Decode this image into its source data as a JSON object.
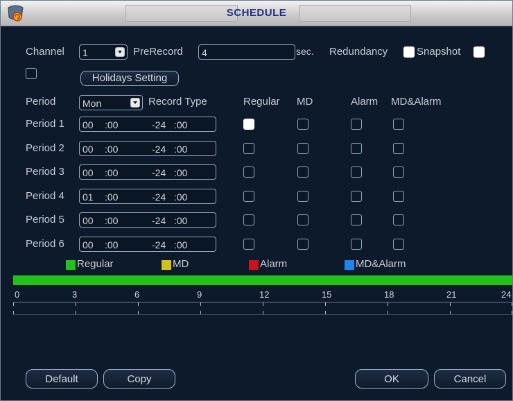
{
  "window": {
    "title": "SCHEDULE"
  },
  "channel": {
    "label": "Channel",
    "value": "1"
  },
  "prerecord": {
    "label": "PreRecord",
    "value": "4",
    "unit": "sec."
  },
  "redundancy": {
    "label": "Redundancy",
    "checked": false
  },
  "snapshot": {
    "label": "Snapshot",
    "checked": false
  },
  "holidays": {
    "button_label": "Holidays Setting",
    "checked": false
  },
  "header": {
    "period": "Period",
    "day": "Mon",
    "record_type": "Record Type",
    "regular": "Regular",
    "md": "MD",
    "alarm": "Alarm",
    "md_alarm": "MD&Alarm"
  },
  "periods": [
    {
      "label": "Period 1",
      "start_h": "00",
      "start_m": ":00",
      "end_h": "-24",
      "end_m": ":00",
      "regular": true,
      "md": false,
      "alarm": false,
      "md_alarm": false
    },
    {
      "label": "Period 2",
      "start_h": "00",
      "start_m": ":00",
      "end_h": "-24",
      "end_m": ":00",
      "regular": false,
      "md": false,
      "alarm": false,
      "md_alarm": false
    },
    {
      "label": "Period 3",
      "start_h": "00",
      "start_m": ":00",
      "end_h": "-24",
      "end_m": ":00",
      "regular": false,
      "md": false,
      "alarm": false,
      "md_alarm": false
    },
    {
      "label": "Period 4",
      "start_h": "01",
      "start_m": ":00",
      "end_h": "-24",
      "end_m": ":00",
      "regular": false,
      "md": false,
      "alarm": false,
      "md_alarm": false
    },
    {
      "label": "Period 5",
      "start_h": "00",
      "start_m": ":00",
      "end_h": "-24",
      "end_m": ":00",
      "regular": false,
      "md": false,
      "alarm": false,
      "md_alarm": false
    },
    {
      "label": "Period 6",
      "start_h": "00",
      "start_m": ":00",
      "end_h": "-24",
      "end_m": ":00",
      "regular": false,
      "md": false,
      "alarm": false,
      "md_alarm": false
    }
  ],
  "legend": [
    {
      "label": "Regular",
      "color": "#22c21d"
    },
    {
      "label": "MD",
      "color": "#d4c21a"
    },
    {
      "label": "Alarm",
      "color": "#c8141a"
    },
    {
      "label": "MD&Alarm",
      "color": "#1a86ee"
    }
  ],
  "timeline": {
    "ticks": [
      "0",
      "3",
      "6",
      "9",
      "12",
      "15",
      "18",
      "21",
      "24"
    ],
    "bar_color": "#22c21d",
    "bar_start_hour": 0,
    "bar_end_hour": 24
  },
  "buttons": {
    "default": "Default",
    "copy": "Copy",
    "ok": "OK",
    "cancel": "Cancel"
  },
  "icons": {
    "app": "app-logo-icon",
    "dropdown": "chevron-down-icon"
  }
}
